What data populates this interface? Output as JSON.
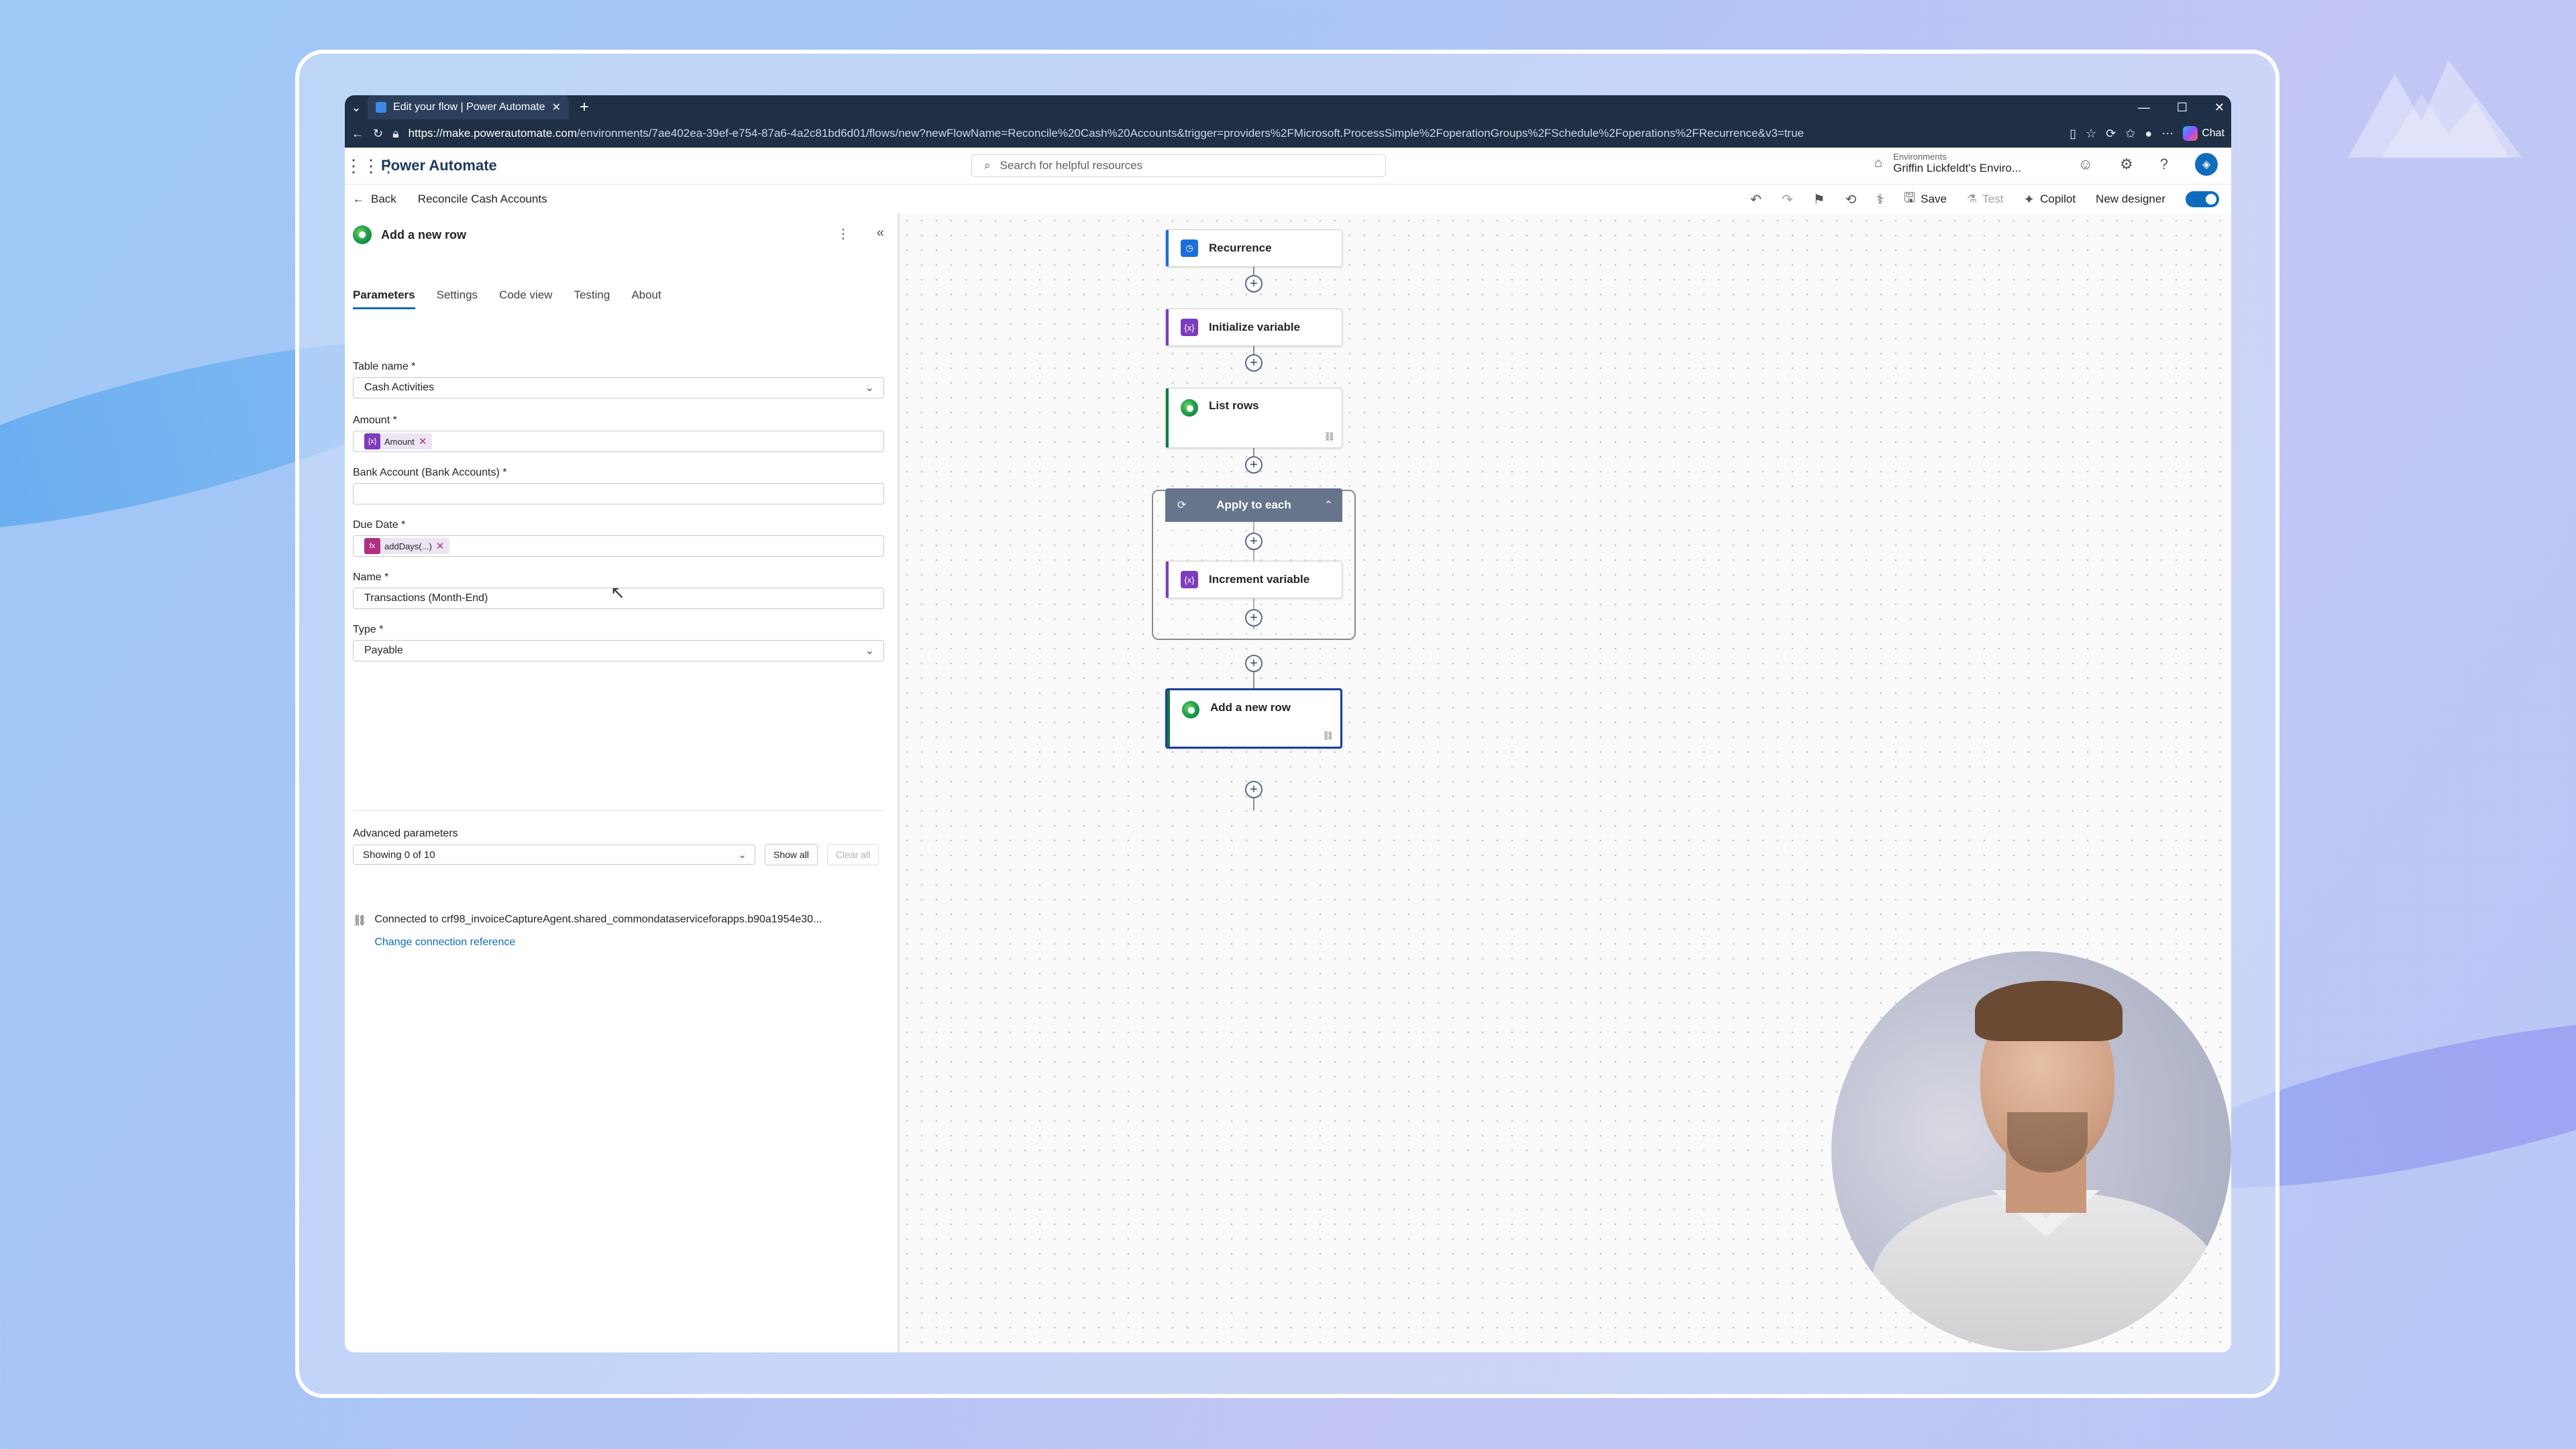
{
  "browser": {
    "tab_title": "Edit your flow | Power Automate",
    "url_host": "https://make.powerautomate.com",
    "url_path": "/environments/7ae402ea-39ef-e754-87a6-4a2c81bd6d01/flows/new?newFlowName=Reconcile%20Cash%20Accounts&trigger=providers%2FMicrosoft.ProcessSimple%2FoperationGroups%2FSchedule%2Foperations%2FRecurrence&v3=true",
    "chat_label": "Chat"
  },
  "app": {
    "name": "Power Automate",
    "search_placeholder": "Search for helpful resources",
    "env_label": "Environments",
    "env_value": "Griffin Lickfeldt's Enviro..."
  },
  "command_bar": {
    "back_label": "Back",
    "flow_name": "Reconcile Cash Accounts",
    "save_label": "Save",
    "test_label": "Test",
    "copilot_label": "Copilot",
    "new_designer_label": "New designer",
    "new_designer_on": true
  },
  "panel": {
    "title": "Add a new row",
    "tabs": [
      "Parameters",
      "Settings",
      "Code view",
      "Testing",
      "About"
    ],
    "active_tab": "Parameters",
    "fields": {
      "table_name": {
        "label": "Table name *",
        "value": "Cash Activities"
      },
      "amount": {
        "label": "Amount *",
        "token": "Amount",
        "token_icon": "{x}"
      },
      "bank_account": {
        "label": "Bank Account (Bank Accounts) *",
        "value": ""
      },
      "due_date": {
        "label": "Due Date *",
        "token": "addDays(...)",
        "token_icon": "fx"
      },
      "name": {
        "label": "Name *",
        "value": "Transactions (Month-End)"
      },
      "type": {
        "label": "Type *",
        "value": "Payable"
      }
    },
    "advanced": {
      "label": "Advanced parameters",
      "select_value": "Showing 0 of 10",
      "show_all": "Show all",
      "clear_all": "Clear all"
    },
    "connection": {
      "text": "Connected to crf98_invoiceCaptureAgent.shared_commondataserviceforapps.b90a1954e30...",
      "link": "Change connection reference"
    }
  },
  "flow": {
    "recurrence": "Recurrence",
    "initialize_variable": "Initialize variable",
    "list_rows": "List rows",
    "apply_to_each": "Apply to each",
    "increment_variable": "Increment variable",
    "add_row": "Add a new row"
  }
}
